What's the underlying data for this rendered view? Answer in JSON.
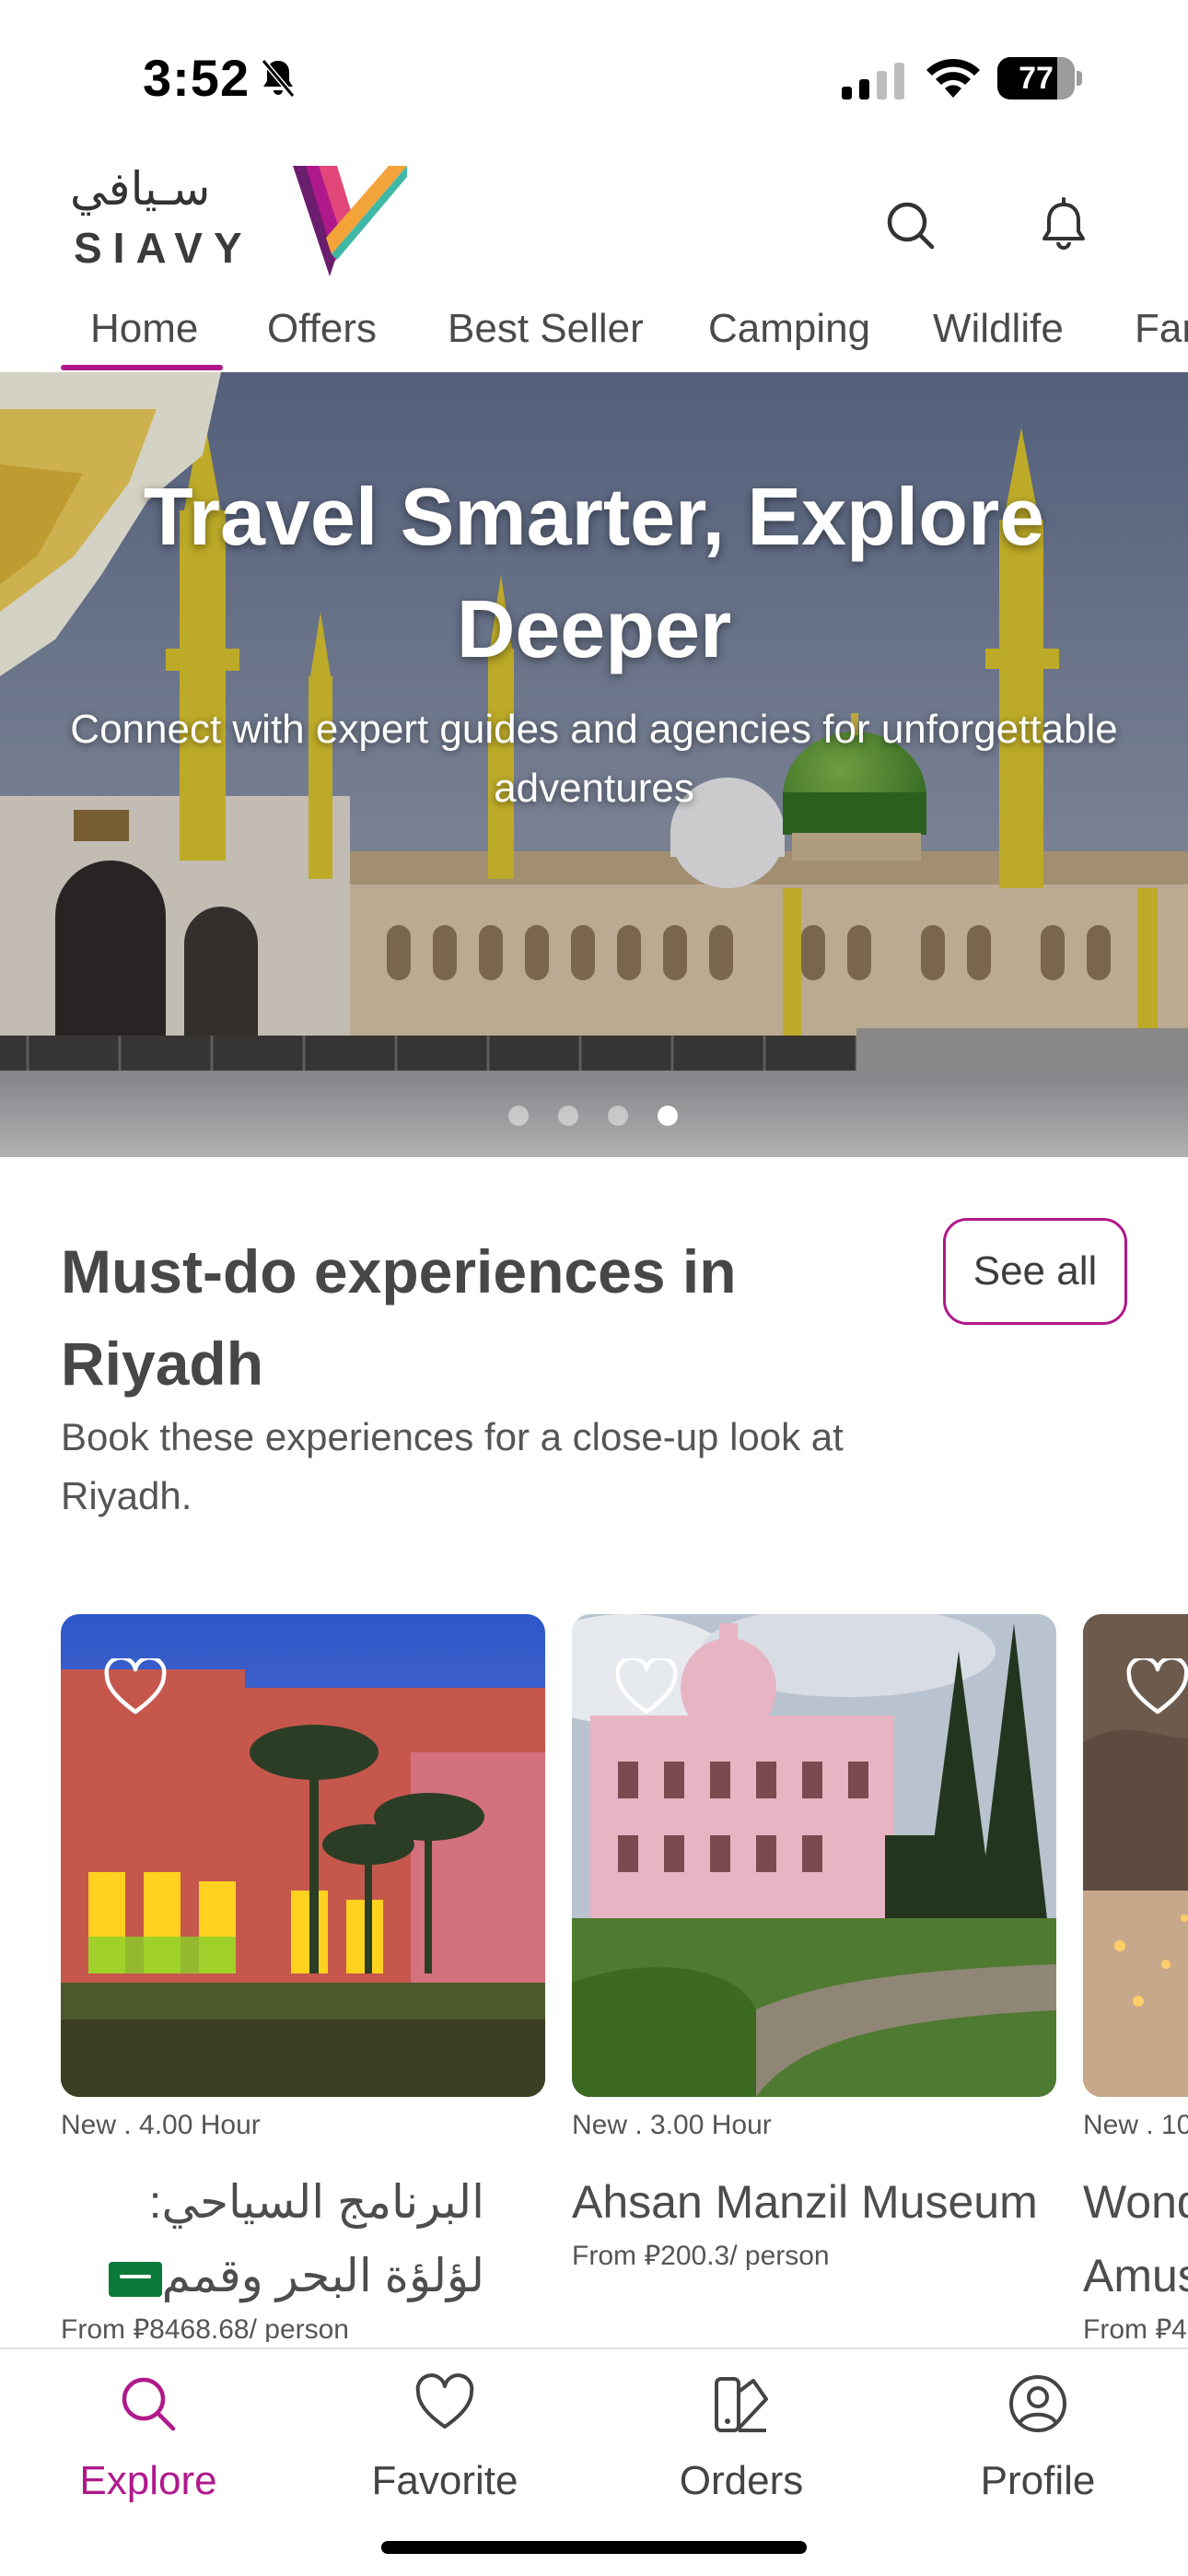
{
  "status_bar": {
    "time": "3:52",
    "battery": "77",
    "battery_level": 0.77,
    "icons": [
      "bell-slash-icon",
      "cellular-signal-icon",
      "wifi-icon",
      "battery-icon"
    ]
  },
  "header": {
    "logo_arabic": "سـيافي",
    "logo_latin": "SIAVY",
    "icons": [
      "search-icon",
      "bell-icon"
    ]
  },
  "tabs": [
    {
      "label": "Home",
      "active": true
    },
    {
      "label": "Offers",
      "active": false
    },
    {
      "label": "Best Seller",
      "active": false
    },
    {
      "label": "Camping",
      "active": false
    },
    {
      "label": "Wildlife",
      "active": false
    },
    {
      "label": "Far",
      "active": false
    }
  ],
  "hero": {
    "title": "Travel Smarter, Explore Deeper",
    "subtitle": "Connect with expert guides and agencies for unforgettable adventures",
    "dots": 4,
    "active_dot": 4
  },
  "section": {
    "title": "Must-do experiences in Riyadh",
    "subtitle": "Book these experiences for a close-up look at Riyadh.",
    "see_all": "See all"
  },
  "cards": [
    {
      "meta": "New . 4.00 Hour",
      "title": "البرنامج السياحي: لؤلؤة البحر وقمم",
      "price": "From ⃁8468.68/ person",
      "rtl": true,
      "favorite_icon": "heart-outline-icon"
    },
    {
      "meta": "New . 3.00 Hour",
      "title": "Ahsan Manzil Museum",
      "price": "From ⃁200.3/ person",
      "rtl": false,
      "favorite_icon": "heart-outline-icon"
    },
    {
      "meta": "New . 10",
      "title": "Wond",
      "title_line2": "Amus",
      "price": "From ⃁4",
      "rtl": false,
      "favorite_icon": "heart-outline-icon"
    }
  ],
  "bottom_nav": [
    {
      "label": "Explore",
      "icon": "search-icon",
      "active": true
    },
    {
      "label": "Favorite",
      "icon": "heart-icon",
      "active": false
    },
    {
      "label": "Orders",
      "icon": "orders-icon",
      "active": false
    },
    {
      "label": "Profile",
      "icon": "user-circle-icon",
      "active": false
    }
  ],
  "colors": {
    "accent": "#b0198b",
    "text": "#3d3d3d"
  }
}
